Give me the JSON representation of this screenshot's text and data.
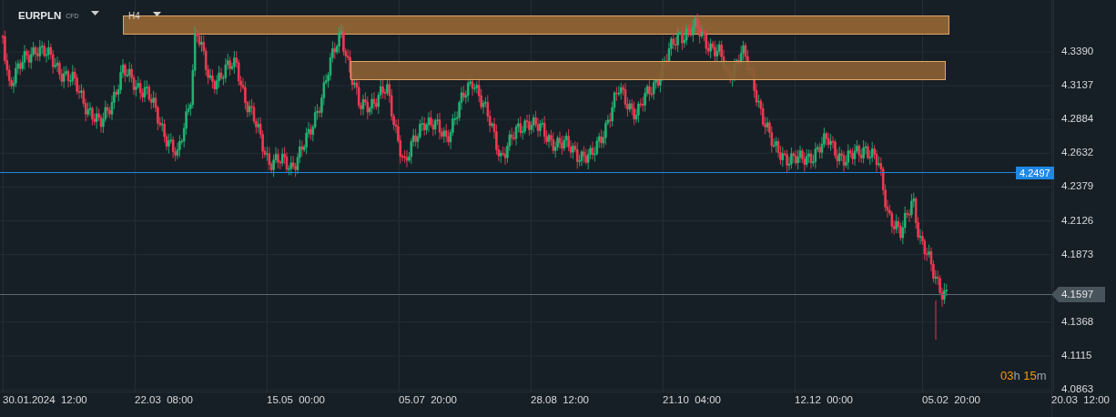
{
  "header": {
    "symbol": "EURPLN",
    "instrument_type": "CFD",
    "timeframe": "H4"
  },
  "price_axis": {
    "ticks": [
      "4.3390",
      "4.3137",
      "4.2884",
      "4.2632",
      "4.2379",
      "4.2126",
      "4.1873",
      "4.1368",
      "4.1115",
      "4.0863"
    ]
  },
  "time_axis": {
    "ticks": [
      "30.01.2024  12:00",
      "22.03  08:00",
      "15.05  00:00",
      "05.07  20:00",
      "28.08  12:00",
      "21.10  04:00",
      "12.12  00:00",
      "05.02  20:00",
      "20.03  12:00"
    ]
  },
  "horizontal_line": {
    "label": "4.2497"
  },
  "current_price": {
    "label": "4.1597"
  },
  "countdown": [
    {
      "text": "03",
      "kind": "number"
    },
    {
      "text": "h ",
      "kind": "unit"
    },
    {
      "text": "15",
      "kind": "number"
    },
    {
      "text": "m",
      "kind": "unit"
    }
  ]
}
